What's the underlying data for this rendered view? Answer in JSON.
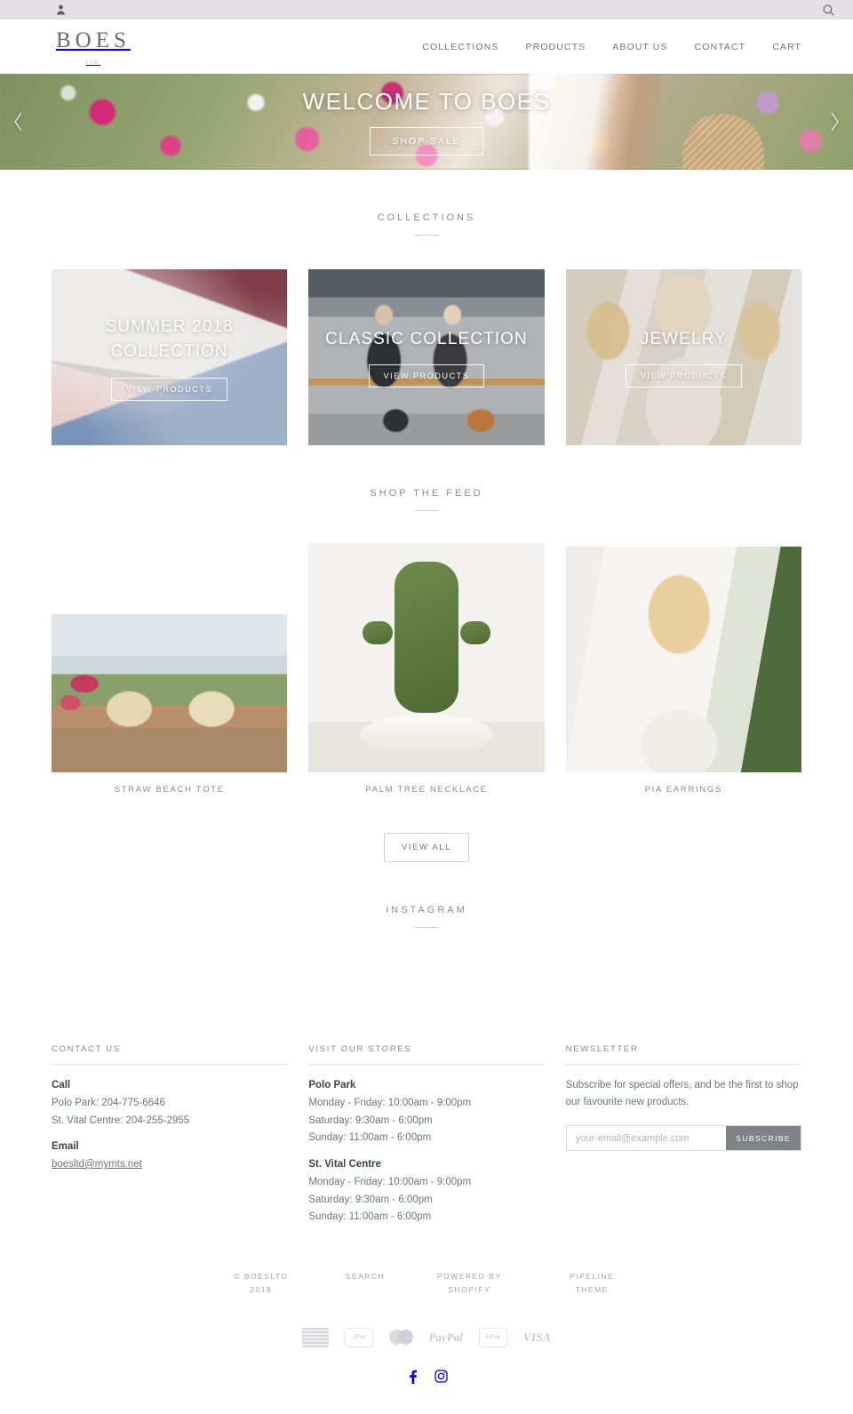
{
  "utility_bar": {
    "account_icon": "user-icon",
    "search_icon": "search-icon"
  },
  "header": {
    "brand_name": "BOES",
    "brand_sub": "LTD.",
    "nav": [
      {
        "label": "COLLECTIONS"
      },
      {
        "label": "PRODUCTS"
      },
      {
        "label": "ABOUT US"
      },
      {
        "label": "CONTACT"
      },
      {
        "label": "CART"
      }
    ]
  },
  "hero": {
    "title": "WELCOME TO BOES",
    "button": "SHOP SALE",
    "prev_icon": "chevron-left-icon",
    "next_icon": "chevron-right-icon"
  },
  "collections": {
    "heading": "COLLECTIONS",
    "cards": [
      {
        "title": "SUMMER 2018 COLLECTION",
        "button": "VIEW PRODUCTS"
      },
      {
        "title": "CLASSIC COLLECTION",
        "button": "VIEW PRODUCTS"
      },
      {
        "title": "JEWELRY",
        "button": "VIEW PRODUCTS"
      }
    ]
  },
  "feed": {
    "heading": "SHOP THE FEED",
    "items": [
      {
        "label": "STRAW BEACH TOTE"
      },
      {
        "label": "PALM TREE NECKLACE"
      },
      {
        "label": "PIA EARRINGS"
      }
    ],
    "view_all": "VIEW ALL"
  },
  "instagram": {
    "heading": "INSTAGRAM"
  },
  "footer": {
    "contact": {
      "title": "CONTACT US",
      "call_label": "Call",
      "phone_1": "Polo Park: 204-775-6646",
      "phone_2": "St. Vital Centre: 204-255-2955",
      "email_label": "Email",
      "email": "boesltd@mymts.net"
    },
    "stores": {
      "title": "VISIT OUR STORES",
      "store_1": {
        "name": "Polo Park",
        "hours_1": "Monday - Friday: 10:00am - 9:00pm",
        "hours_2": "Saturday: 9:30am - 6:00pm",
        "hours_3": "Sunday: 11:00am - 6:00pm"
      },
      "store_2": {
        "name": "St. Vital Centre",
        "hours_1": "Monday - Friday: 10:00am - 9:00pm",
        "hours_2": "Saturday: 9:30am - 6:00pm",
        "hours_3": "Sunday: 11:00am - 6:00pm"
      }
    },
    "newsletter": {
      "title": "NEWSLETTER",
      "copy": "Subscribe for special offers, and be the first to shop our favourite new products.",
      "placeholder": "your-email@example.com",
      "button": "SUBSCRIBE"
    },
    "bottom": {
      "copyright": "© BOESLTD 2018",
      "search": "SEARCH",
      "powered_by": "POWERED BY SHOPIFY",
      "theme": "PIPELINE THEME"
    },
    "payments": [
      {
        "name": "american-express"
      },
      {
        "name": "apple-pay",
        "label": "Pay"
      },
      {
        "name": "mastercard"
      },
      {
        "name": "paypal",
        "label": "PayPal"
      },
      {
        "name": "google-pay",
        "label": "Pay"
      },
      {
        "name": "visa",
        "label": "VISA"
      }
    ],
    "socials": [
      {
        "name": "facebook-icon"
      },
      {
        "name": "instagram-icon"
      }
    ]
  },
  "colors": {
    "utility_bar_bg": "#e4e0e4",
    "text_muted": "#8a8a90",
    "subscribe_bg": "#7e8387"
  }
}
